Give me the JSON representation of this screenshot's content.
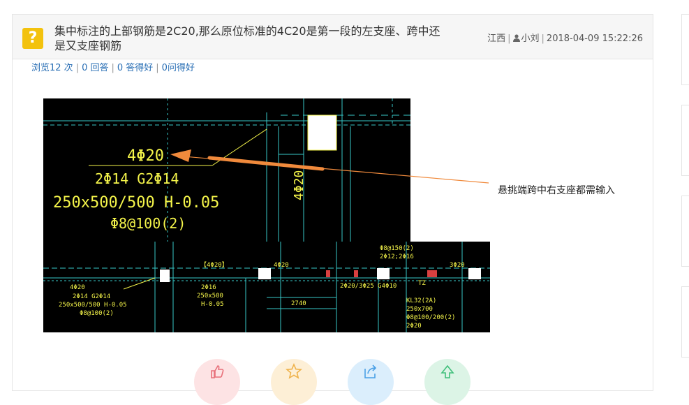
{
  "question": {
    "title": "集中标注的上部钢筋是2C20,那么原位标准的4C20是第一段的左支座、跨中还是又支座钢筋",
    "region": "江西",
    "user": "小刘",
    "datetime": "2018-04-09 15:22:26"
  },
  "stats": {
    "views": "浏览12 次",
    "answers": "0 回答",
    "good_answers": "0 答得好",
    "good_questions": "0问得好"
  },
  "figure": {
    "callout_text": "悬挑端跨中右支座都需输入",
    "top_annotation": {
      "line1": "4Φ20",
      "line2": "2Φ14  G2Φ14",
      "line3": "250x500/500  H-0.05",
      "line4": "Φ8@100(2)",
      "vertical": "4Φ20"
    },
    "bottom_annotation": {
      "a1": "4Φ20",
      "a2": "2Φ14  G2Φ14",
      "a3": "250x500/500  H-0.05",
      "a4": "Φ8@100(2)",
      "b1": "【4Φ20】",
      "b2": "4Φ20",
      "b3": "2Φ16",
      "b4": "250x500",
      "b5": "H-0.05",
      "c1": "2Φ20/3Φ25  G4Φ10",
      "c2": "2740",
      "d1": "Φ8@150(2)",
      "d2": "2Φ12;2Φ16",
      "e1": "KL32(2A)",
      "e2": "250x700",
      "e3": "Φ8@100/200(2)",
      "e4": "2Φ20",
      "e5": "TZ",
      "f1": "3Φ20"
    }
  },
  "colors": {
    "cad_bg": "#000000",
    "cad_yellow": "#f5f54a",
    "cad_cyan": "#37c8c8",
    "cad_white": "#ffffff",
    "arrow": "#f08a3c",
    "link": "#2a6fb5",
    "badge": "#f3c20d"
  }
}
